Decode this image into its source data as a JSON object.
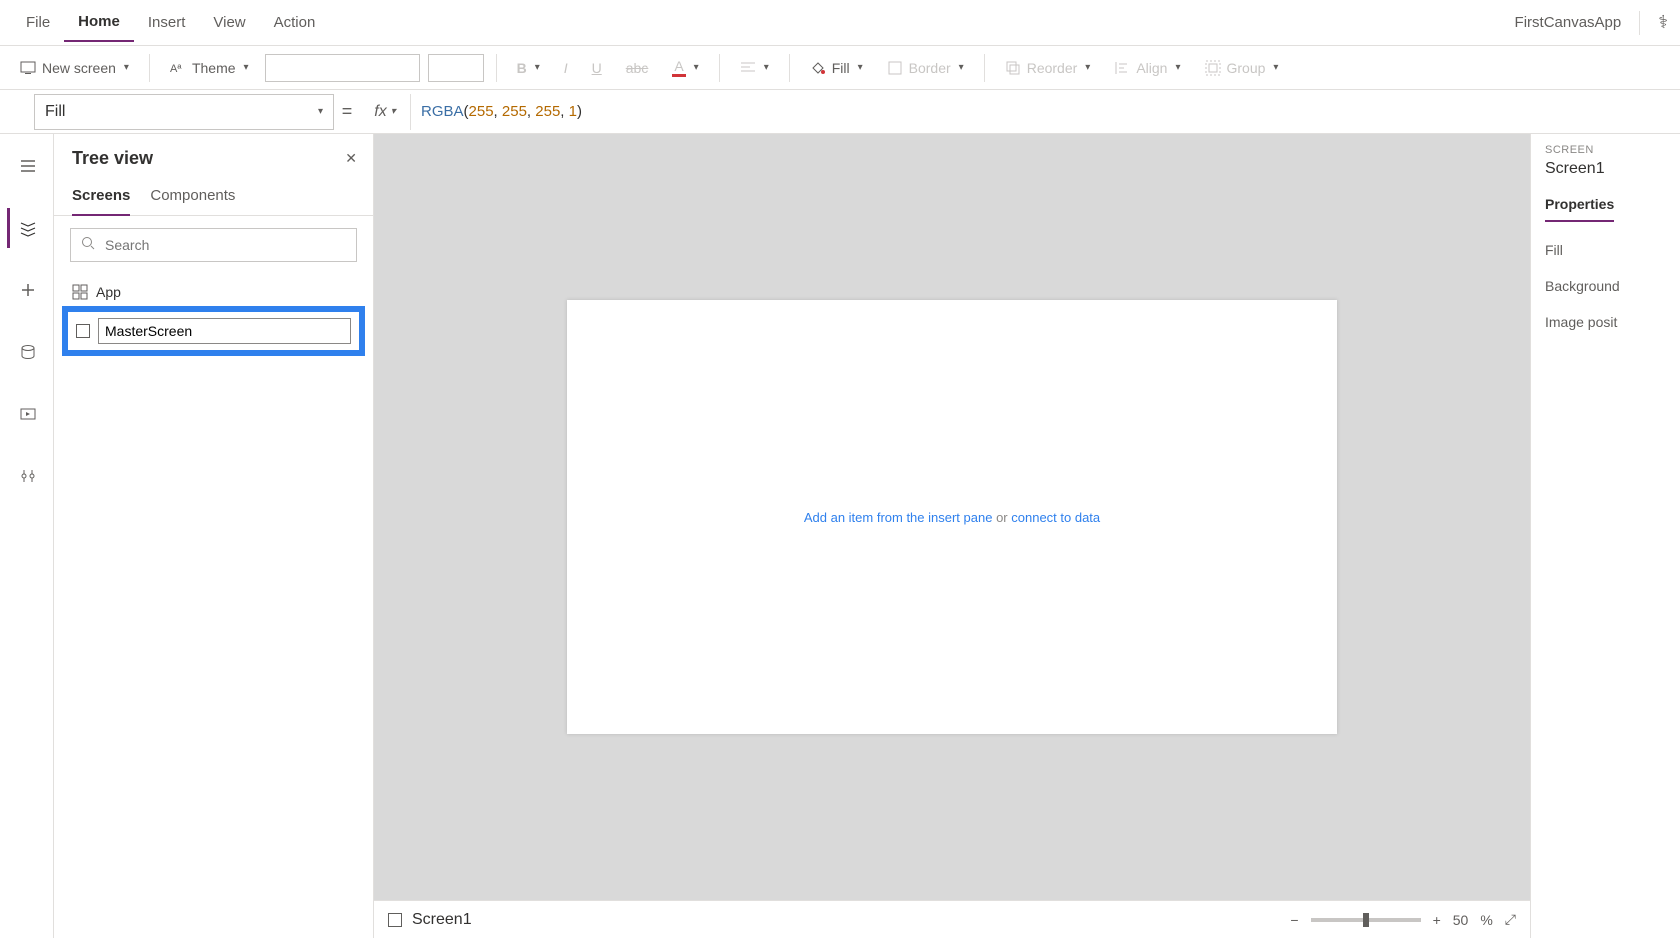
{
  "menu": {
    "file": "File",
    "home": "Home",
    "insert": "Insert",
    "view": "View",
    "action": "Action"
  },
  "app_name": "FirstCanvasApp",
  "ribbon": {
    "new_screen": "New screen",
    "theme": "Theme",
    "fill": "Fill",
    "border": "Border",
    "reorder": "Reorder",
    "align": "Align",
    "group": "Group"
  },
  "formula": {
    "property": "Fill",
    "fn": "RGBA",
    "a": "255",
    "b": "255",
    "c": "255",
    "d": "1"
  },
  "tree": {
    "title": "Tree view",
    "tab_screens": "Screens",
    "tab_components": "Components",
    "search_placeholder": "Search",
    "app_label": "App",
    "rename_value": "MasterScreen"
  },
  "canvas": {
    "msg_prefix": "Add an item from the insert pane",
    "msg_or": " or ",
    "msg_link": "connect to data"
  },
  "status": {
    "screen": "Screen1",
    "zoom": "50",
    "pct": "%"
  },
  "props": {
    "category": "SCREEN",
    "name": "Screen1",
    "tab": "Properties",
    "fill": "Fill",
    "bg": "Background",
    "imgpos": "Image posit"
  }
}
